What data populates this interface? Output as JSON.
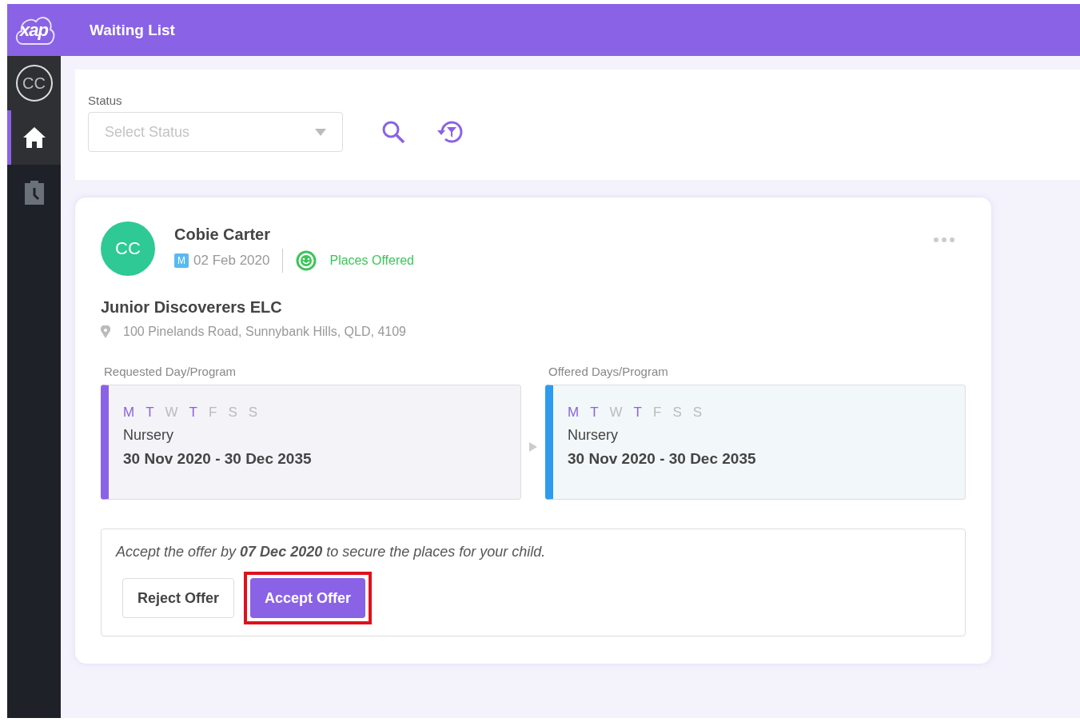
{
  "header": {
    "logo": "xap",
    "title": "Waiting List"
  },
  "sidebar": {
    "avatar": "CC",
    "items": [
      {
        "kind": "home",
        "selected": true
      },
      {
        "kind": "clipboard",
        "selected": false
      }
    ]
  },
  "filter": {
    "label": "Status",
    "placeholder": "Select Status"
  },
  "card": {
    "initials": "CC",
    "name": "Cobie Carter",
    "badge": "M",
    "date": "02 Feb 2020",
    "status": "Places Offered",
    "center": "Junior Discoverers ELC",
    "address": "100 Pinelands Road, Sunnybank Hills, QLD, 4109",
    "programs": [
      {
        "kind": "requested",
        "heading": "Requested Day/Program",
        "days": [
          {
            "label": "M",
            "selected": true
          },
          {
            "label": "T",
            "selected": true
          },
          {
            "label": "W",
            "selected": false
          },
          {
            "label": "T",
            "selected": true
          },
          {
            "label": "F",
            "selected": false
          },
          {
            "label": "S",
            "selected": false
          },
          {
            "label": "S",
            "selected": false
          }
        ],
        "program": "Nursery",
        "range": "30 Nov 2020 - 30 Dec 2035"
      },
      {
        "kind": "offered",
        "heading": "Offered Days/Program",
        "days": [
          {
            "label": "M",
            "selected": true
          },
          {
            "label": "T",
            "selected": true
          },
          {
            "label": "W",
            "selected": false
          },
          {
            "label": "T",
            "selected": true
          },
          {
            "label": "F",
            "selected": false
          },
          {
            "label": "S",
            "selected": false
          },
          {
            "label": "S",
            "selected": false
          }
        ],
        "program": "Nursery",
        "range": "30 Nov 2020 - 30 Dec 2035"
      }
    ],
    "offer_text": "Accept the offer by **07 Dec 2020** to secure the places for your child.",
    "buttons": [
      {
        "kind": "secondary",
        "label": "Reject Offer",
        "highlighted": false
      },
      {
        "kind": "primary",
        "label": "Accept Offer",
        "highlighted": true
      }
    ]
  }
}
